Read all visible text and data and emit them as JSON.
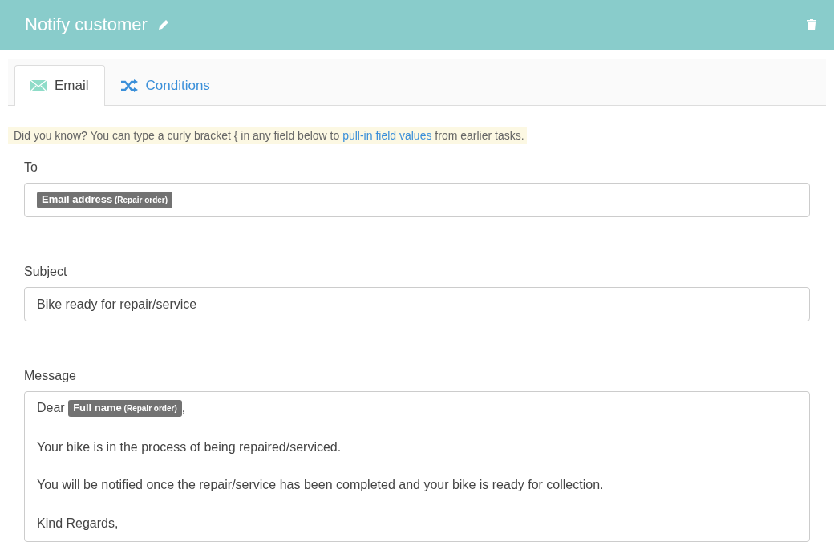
{
  "header": {
    "title": "Notify customer"
  },
  "tabs": [
    {
      "label": "Email",
      "kind": "email",
      "selected": true
    },
    {
      "label": "Conditions",
      "kind": "conditions",
      "selected": false
    }
  ],
  "hint": {
    "before": "Did you know? You can type a curly bracket { in any field below to ",
    "link": "pull-in field values",
    "after": " from earlier tasks."
  },
  "to": {
    "label": "To",
    "tokens": [
      {
        "label": "Email address",
        "source": "(Repair order)"
      }
    ]
  },
  "subject": {
    "label": "Subject",
    "value": "Bike ready for repair/service"
  },
  "message": {
    "label": "Message",
    "lines": [
      [
        {
          "kind": "text",
          "text": "Dear "
        },
        {
          "kind": "token",
          "label": "Full name",
          "source": "(Repair order)"
        },
        {
          "kind": "text",
          "text": ","
        }
      ],
      [
        {
          "kind": "text",
          "text": "Your bike is in the process of being repaired/serviced."
        }
      ],
      [
        {
          "kind": "text",
          "text": "You will be notified once the repair/service has been completed and your bike is ready for collection."
        }
      ],
      [
        {
          "kind": "text",
          "text": "Kind Regards,"
        }
      ]
    ]
  }
}
